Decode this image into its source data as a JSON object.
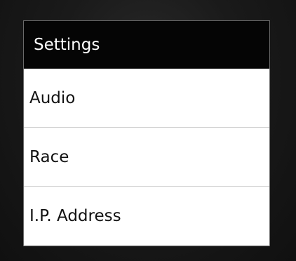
{
  "dialog": {
    "title": "Settings",
    "items": [
      {
        "label": "Audio"
      },
      {
        "label": "Race"
      },
      {
        "label": "I.P. Address"
      }
    ]
  }
}
